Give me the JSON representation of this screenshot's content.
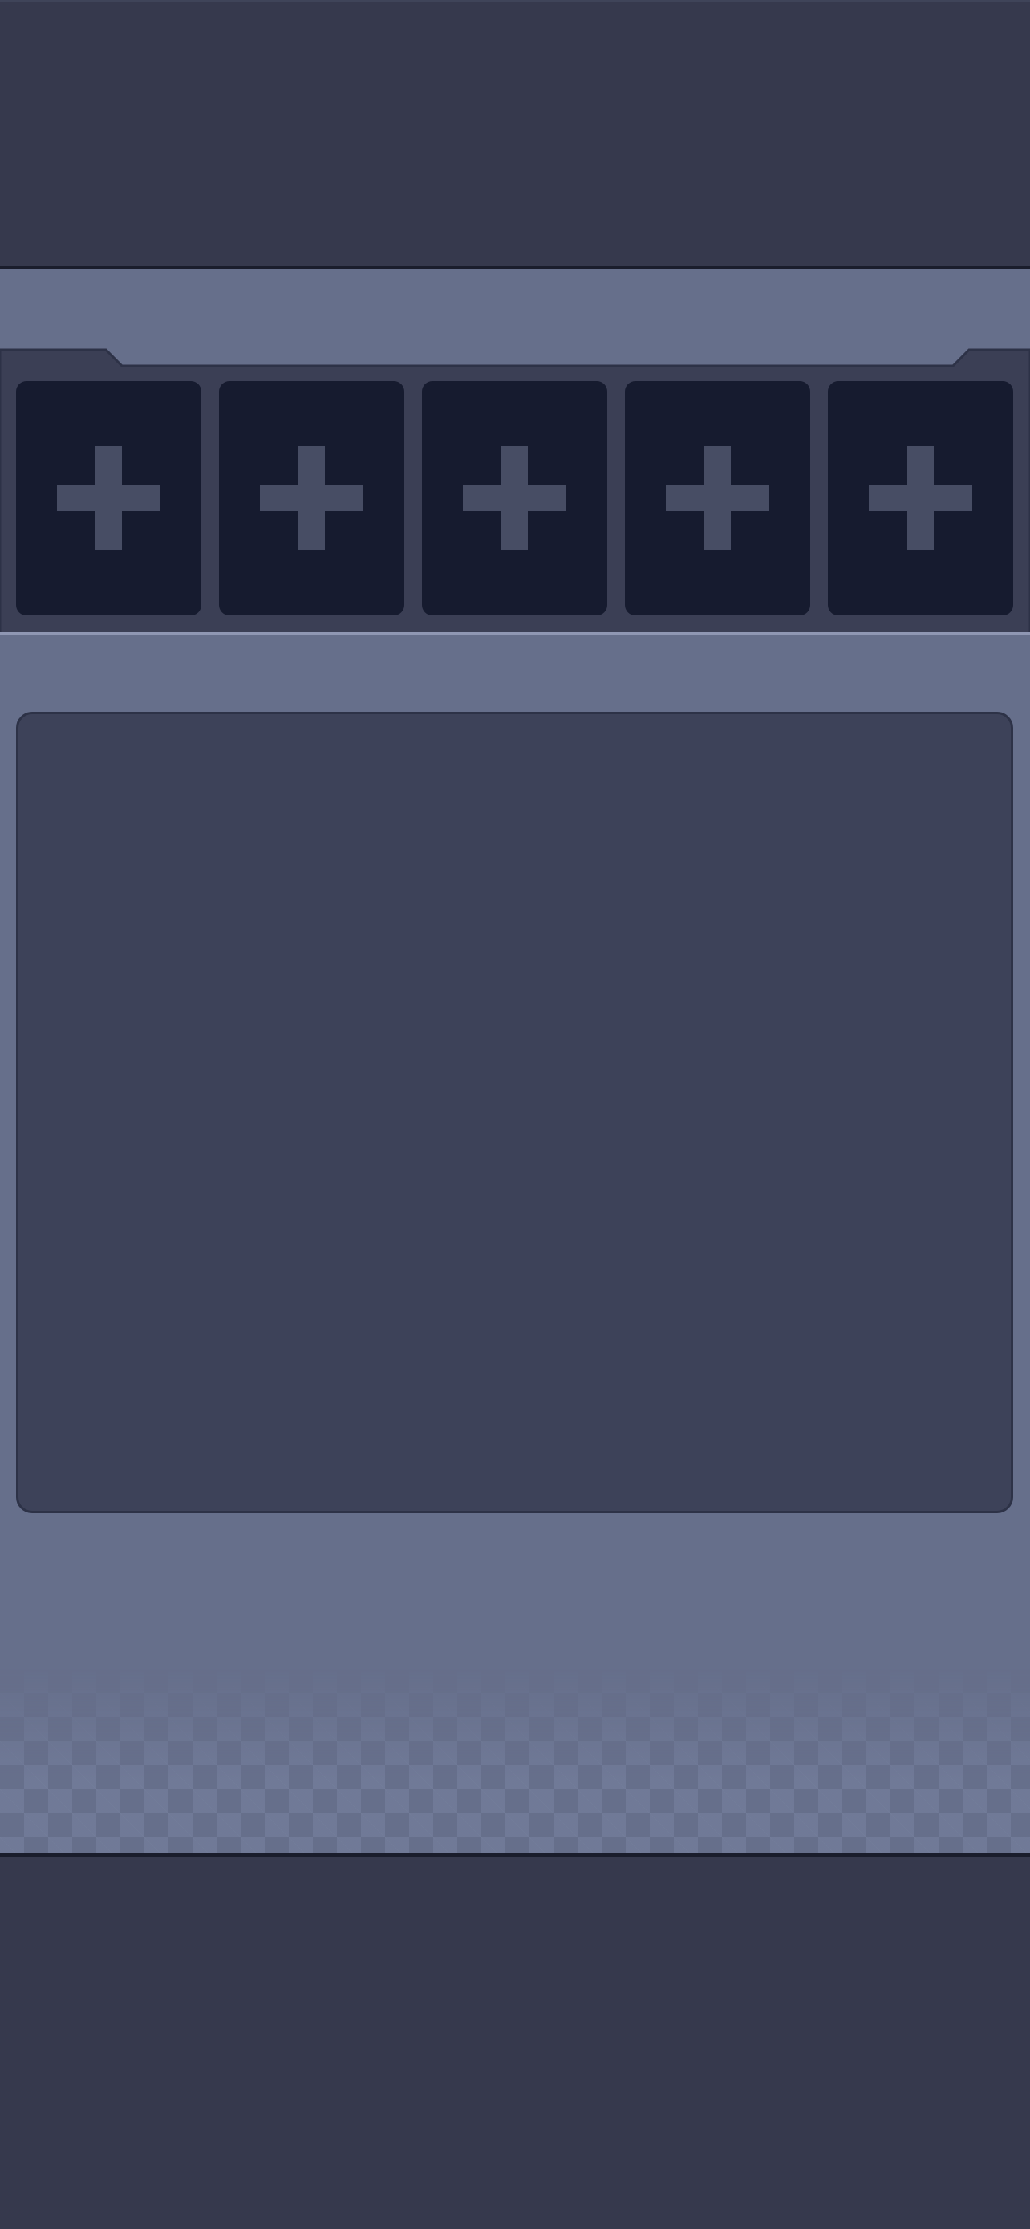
{
  "theme": {
    "background": "#666f8b",
    "bar_color": "#36394d",
    "slot_color": "#161b2f",
    "panel_color": "#3d4259",
    "icon_color": "#474d64"
  },
  "slots": [
    {
      "icon": "plus-icon",
      "state": "empty"
    },
    {
      "icon": "plus-icon",
      "state": "empty"
    },
    {
      "icon": "plus-icon",
      "state": "empty"
    },
    {
      "icon": "plus-icon",
      "state": "empty"
    },
    {
      "icon": "plus-icon",
      "state": "empty"
    }
  ]
}
